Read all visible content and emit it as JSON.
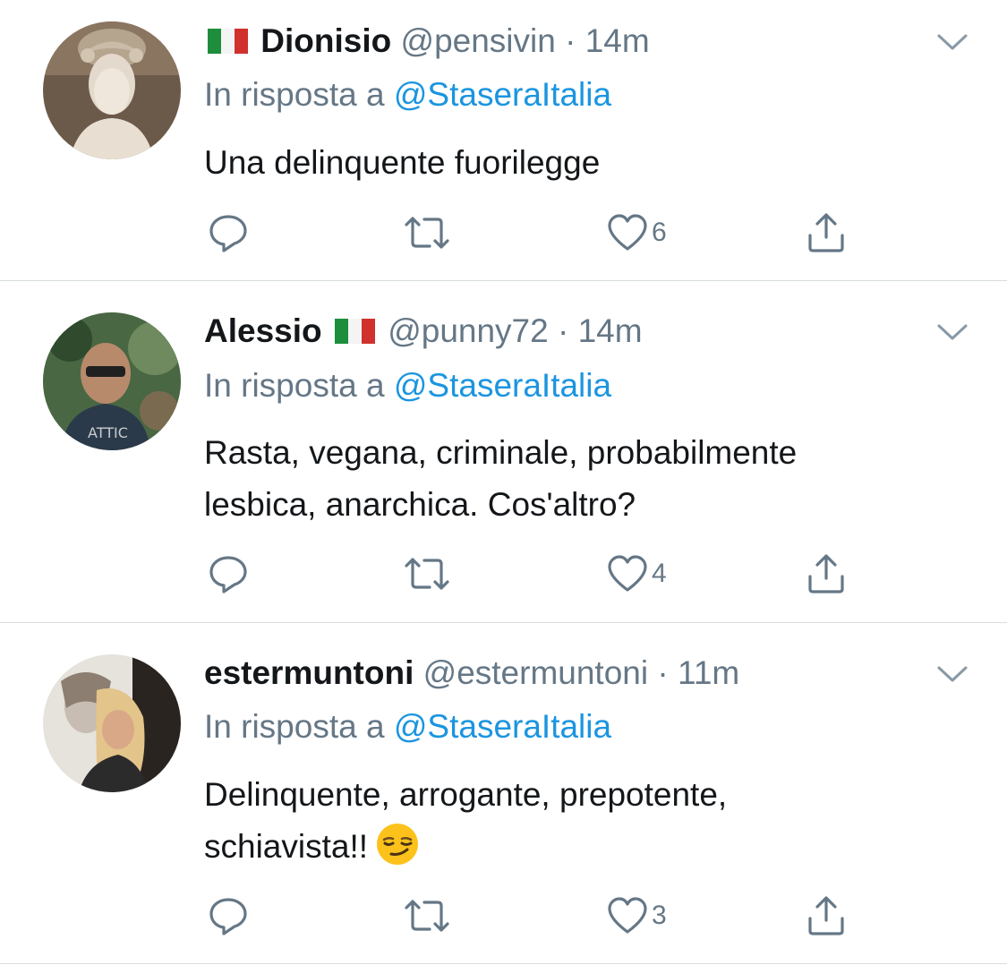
{
  "tweets": [
    {
      "display_name": "Dionisio",
      "flag_position": "before",
      "flag_icon": "italy-flag-icon",
      "handle": "@pensivin",
      "separator": "·",
      "time": "14m",
      "reply_prefix": "In risposta a",
      "reply_to": "@StaseraItalia",
      "text_lines": [
        "Una delinquente fuorilegge"
      ],
      "emoji": "",
      "reply_count": "",
      "retweet_count": "",
      "like_count": "6"
    },
    {
      "display_name": "Alessio",
      "flag_position": "after",
      "flag_icon": "italy-flag-icon",
      "handle": "@punny72",
      "separator": "·",
      "time": "14m",
      "reply_prefix": "In risposta a",
      "reply_to": "@StaseraItalia",
      "text_lines": [
        "Rasta, vegana, criminale, probabilmente",
        "lesbica, anarchica. Cos'altro?"
      ],
      "emoji": "",
      "reply_count": "",
      "retweet_count": "",
      "like_count": "4"
    },
    {
      "display_name": "estermuntoni",
      "flag_position": "none",
      "flag_icon": "",
      "handle": "@estermuntoni",
      "separator": "·",
      "time": "11m",
      "reply_prefix": "In risposta a",
      "reply_to": "@StaseraItalia",
      "text_lines": [
        "Delinquente, arrogante, prepotente,",
        "schiavista!!"
      ],
      "emoji": "smirking-face-emoji",
      "reply_count": "",
      "retweet_count": "",
      "like_count": "3"
    }
  ],
  "colors": {
    "primary_text": "#14171a",
    "secondary_text": "#657786",
    "link": "#1b95e0",
    "divider": "#d9dde1",
    "icon": "#657786"
  },
  "icons": {
    "reply": "reply-icon",
    "retweet": "retweet-icon",
    "like": "heart-icon",
    "share": "share-icon",
    "menu": "chevron-down-icon"
  }
}
